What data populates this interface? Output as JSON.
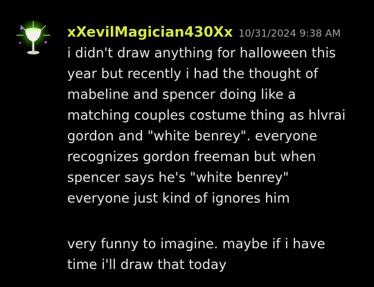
{
  "message": {
    "username": "xXevilMagician430Xx",
    "timestamp": "10/31/2024 9:38 AM",
    "paragraphs": [
      {
        "lines": [
          "i didn't draw anything for halloween this",
          "year but recently i had the thought of",
          "mabeline and spencer doing like a",
          "matching couples costume thing as hlvrai",
          "gordon and \"white benrey\". everyone",
          "recognizes gordon freeman but when",
          "spencer says he's \"white benrey\"",
          "everyone just kind of ignores him"
        ]
      },
      {
        "lines": [
          "very funny to imagine. maybe if i have",
          "time i'll draw that today"
        ]
      }
    ]
  },
  "avatar": {
    "icon": "goblet-sparkle-icon",
    "colors": {
      "background": "#000000",
      "glow": "#7cff2e",
      "accent": "#c04cff",
      "goblet": "#e8e8e0"
    }
  },
  "colors": {
    "background": "#000000",
    "username": "#d5e64e",
    "timestamp": "#a3a6aa",
    "text": "#e6e7e9"
  }
}
